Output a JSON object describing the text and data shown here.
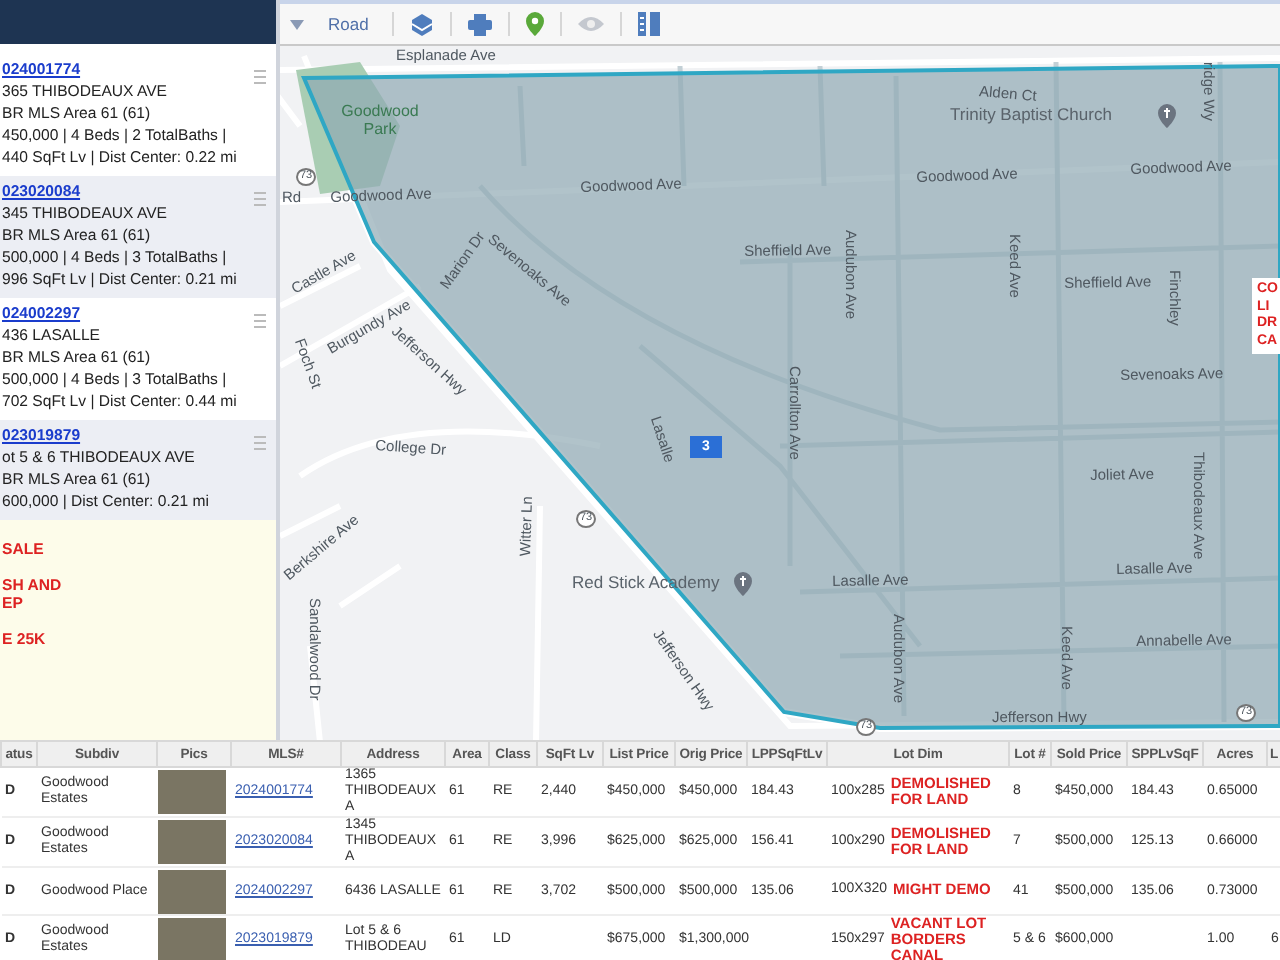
{
  "sidebar": {
    "items": [
      {
        "id": "024001774",
        "lines": [
          "365 THIBODEAUX AVE",
          "BR MLS Area 61 (61)",
          "450,000 | 4 Beds | 2 TotalBaths |",
          "440 SqFt Lv | Dist Center: 0.22 mi"
        ],
        "selected": false
      },
      {
        "id": "023020084",
        "lines": [
          "345 THIBODEAUX AVE",
          "BR MLS Area 61 (61)",
          "500,000 | 4 Beds | 3 TotalBaths |",
          "996 SqFt Lv | Dist Center: 0.21 mi"
        ],
        "selected": true
      },
      {
        "id": "024002297",
        "lines": [
          "436 LASALLE",
          "BR MLS Area 61 (61)",
          "500,000 | 4 Beds | 3 TotalBaths |",
          "702 SqFt Lv | Dist Center: 0.44 mi"
        ],
        "selected": false
      },
      {
        "id": "023019879",
        "lines": [
          "ot 5 & 6 THIBODEAUX AVE",
          "BR MLS Area 61 (61)",
          "600,000 | Dist Center: 0.21 mi"
        ],
        "selected": true
      }
    ],
    "notes": [
      {
        "lines": [
          "SALE"
        ]
      },
      {
        "lines": [
          "SH AND",
          "EP"
        ]
      },
      {
        "lines": [
          "E 25K"
        ]
      }
    ]
  },
  "toolbar": {
    "map_type": "Road"
  },
  "map": {
    "labels": [
      {
        "text": "Esplanade Ave",
        "kind": "street"
      },
      {
        "text": "Alden Ct",
        "kind": "street"
      },
      {
        "text": "Goodwood Park",
        "kind": "park"
      },
      {
        "text": "Trinity Baptist Church",
        "kind": "poi"
      },
      {
        "text": "Goodwood Ave",
        "kind": "street"
      },
      {
        "text": "Goodwood Ave",
        "kind": "street"
      },
      {
        "text": "Goodwood Ave",
        "kind": "street"
      },
      {
        "text": "Goodwood Ave",
        "kind": "street"
      },
      {
        "text": "Rd",
        "kind": "street"
      },
      {
        "text": "Sevenoaks Ave",
        "kind": "street"
      },
      {
        "text": "Sheffield Ave",
        "kind": "street"
      },
      {
        "text": "Sheffield Ave",
        "kind": "street"
      },
      {
        "text": "Castle Ave",
        "kind": "street"
      },
      {
        "text": "Burgundy Ave",
        "kind": "street"
      },
      {
        "text": "Marion Dr",
        "kind": "street"
      },
      {
        "text": "Jefferson Hwy",
        "kind": "street"
      },
      {
        "text": "Foch St",
        "kind": "street"
      },
      {
        "text": "Carrollton Ave",
        "kind": "street"
      },
      {
        "text": "Lasalle",
        "kind": "street"
      },
      {
        "text": "Sevenoaks Ave",
        "kind": "street"
      },
      {
        "text": "College Dr",
        "kind": "street"
      },
      {
        "text": "Joliet Ave",
        "kind": "street"
      },
      {
        "text": "Witter Ln",
        "kind": "street"
      },
      {
        "text": "Berkshire Ave",
        "kind": "street"
      },
      {
        "text": "Sandalwood Dr",
        "kind": "street"
      },
      {
        "text": "Red Stick Academy",
        "kind": "poi"
      },
      {
        "text": "Lasalle Ave",
        "kind": "street"
      },
      {
        "text": "Lasalle Ave",
        "kind": "street"
      },
      {
        "text": "Jefferson Hwy",
        "kind": "street"
      },
      {
        "text": "Annabelle Ave",
        "kind": "street"
      },
      {
        "text": "Audubon Ave",
        "kind": "street"
      },
      {
        "text": "Keed Ave",
        "kind": "street"
      },
      {
        "text": "Keed Ave",
        "kind": "street"
      },
      {
        "text": "Audubon Ave",
        "kind": "street"
      },
      {
        "text": "Finchley",
        "kind": "street"
      },
      {
        "text": "Thibodeaux Ave",
        "kind": "street"
      },
      {
        "text": "Jefferson Hwy",
        "kind": "street"
      },
      {
        "text": "ridge Wy",
        "kind": "street"
      },
      {
        "text": "73",
        "kind": "shield"
      },
      {
        "text": "73",
        "kind": "shield"
      },
      {
        "text": "73",
        "kind": "shield"
      },
      {
        "text": "73",
        "kind": "shield"
      }
    ],
    "markers": [
      {
        "label": "3"
      }
    ],
    "note": {
      "lines": [
        "CO",
        "LI",
        "DR",
        "CA"
      ]
    }
  },
  "table": {
    "columns": [
      {
        "label": "atus",
        "kind": "bold"
      },
      {
        "label": "Subdiv",
        "kind": "text"
      },
      {
        "label": "Pics",
        "kind": "photo"
      },
      {
        "label": "MLS#",
        "kind": "link"
      },
      {
        "label": "Address",
        "kind": "text"
      },
      {
        "label": "Area",
        "kind": "text"
      },
      {
        "label": "Class",
        "kind": "text"
      },
      {
        "label": "SqFt Lv",
        "kind": "text"
      },
      {
        "label": "List Price",
        "kind": "text"
      },
      {
        "label": "Orig Price",
        "kind": "text"
      },
      {
        "label": "LPPSqFtLv",
        "kind": "text"
      },
      {
        "label": "Lot Dim",
        "kind": "lotdim"
      },
      {
        "label": "Lot #",
        "kind": "text"
      },
      {
        "label": "Sold Price",
        "kind": "text"
      },
      {
        "label": "SPPLvSqF",
        "kind": "text"
      },
      {
        "label": "Acres",
        "kind": "text"
      },
      {
        "label": "L",
        "kind": "text"
      }
    ],
    "rows": [
      {
        "cells": [
          "D",
          "Goodwood Estates",
          null,
          "2024001774",
          "1365 THIBODEAUX A",
          "61",
          "RE",
          "2,440",
          "$450,000",
          "$450,000",
          "184.43",
          "100x285",
          "8",
          "$450,000",
          "184.43",
          "0.65000",
          null
        ],
        "note": "DEMOLISHED FOR LAND"
      },
      {
        "cells": [
          "D",
          "Goodwood Estates",
          null,
          "2023020084",
          "1345 THIBODEAUX A",
          "61",
          "RE",
          "3,996",
          "$625,000",
          "$625,000",
          "156.41",
          "100x290",
          "7",
          "$500,000",
          "125.13",
          "0.66000",
          null
        ],
        "note": "DEMOLISHED FOR LAND"
      },
      {
        "cells": [
          "D",
          "Goodwood Place",
          null,
          "2024002297",
          "6436 LASALLE",
          "61",
          "RE",
          "3,702",
          "$500,000",
          "$500,000",
          "135.06",
          "100X320",
          "41",
          "$500,000",
          "135.06",
          "0.73000",
          null
        ],
        "note": "MIGHT DEMO"
      },
      {
        "cells": [
          "D",
          "Goodwood Estates",
          null,
          "2023019879",
          "Lot 5 & 6 THIBODEAU",
          "61",
          "LD",
          null,
          "$675,000",
          "$1,300,000",
          null,
          "150x297",
          "5 & 6",
          "$600,000",
          null,
          "1.00",
          "6"
        ],
        "note": "VACANT LOT BORDERS CANAL"
      }
    ]
  }
}
